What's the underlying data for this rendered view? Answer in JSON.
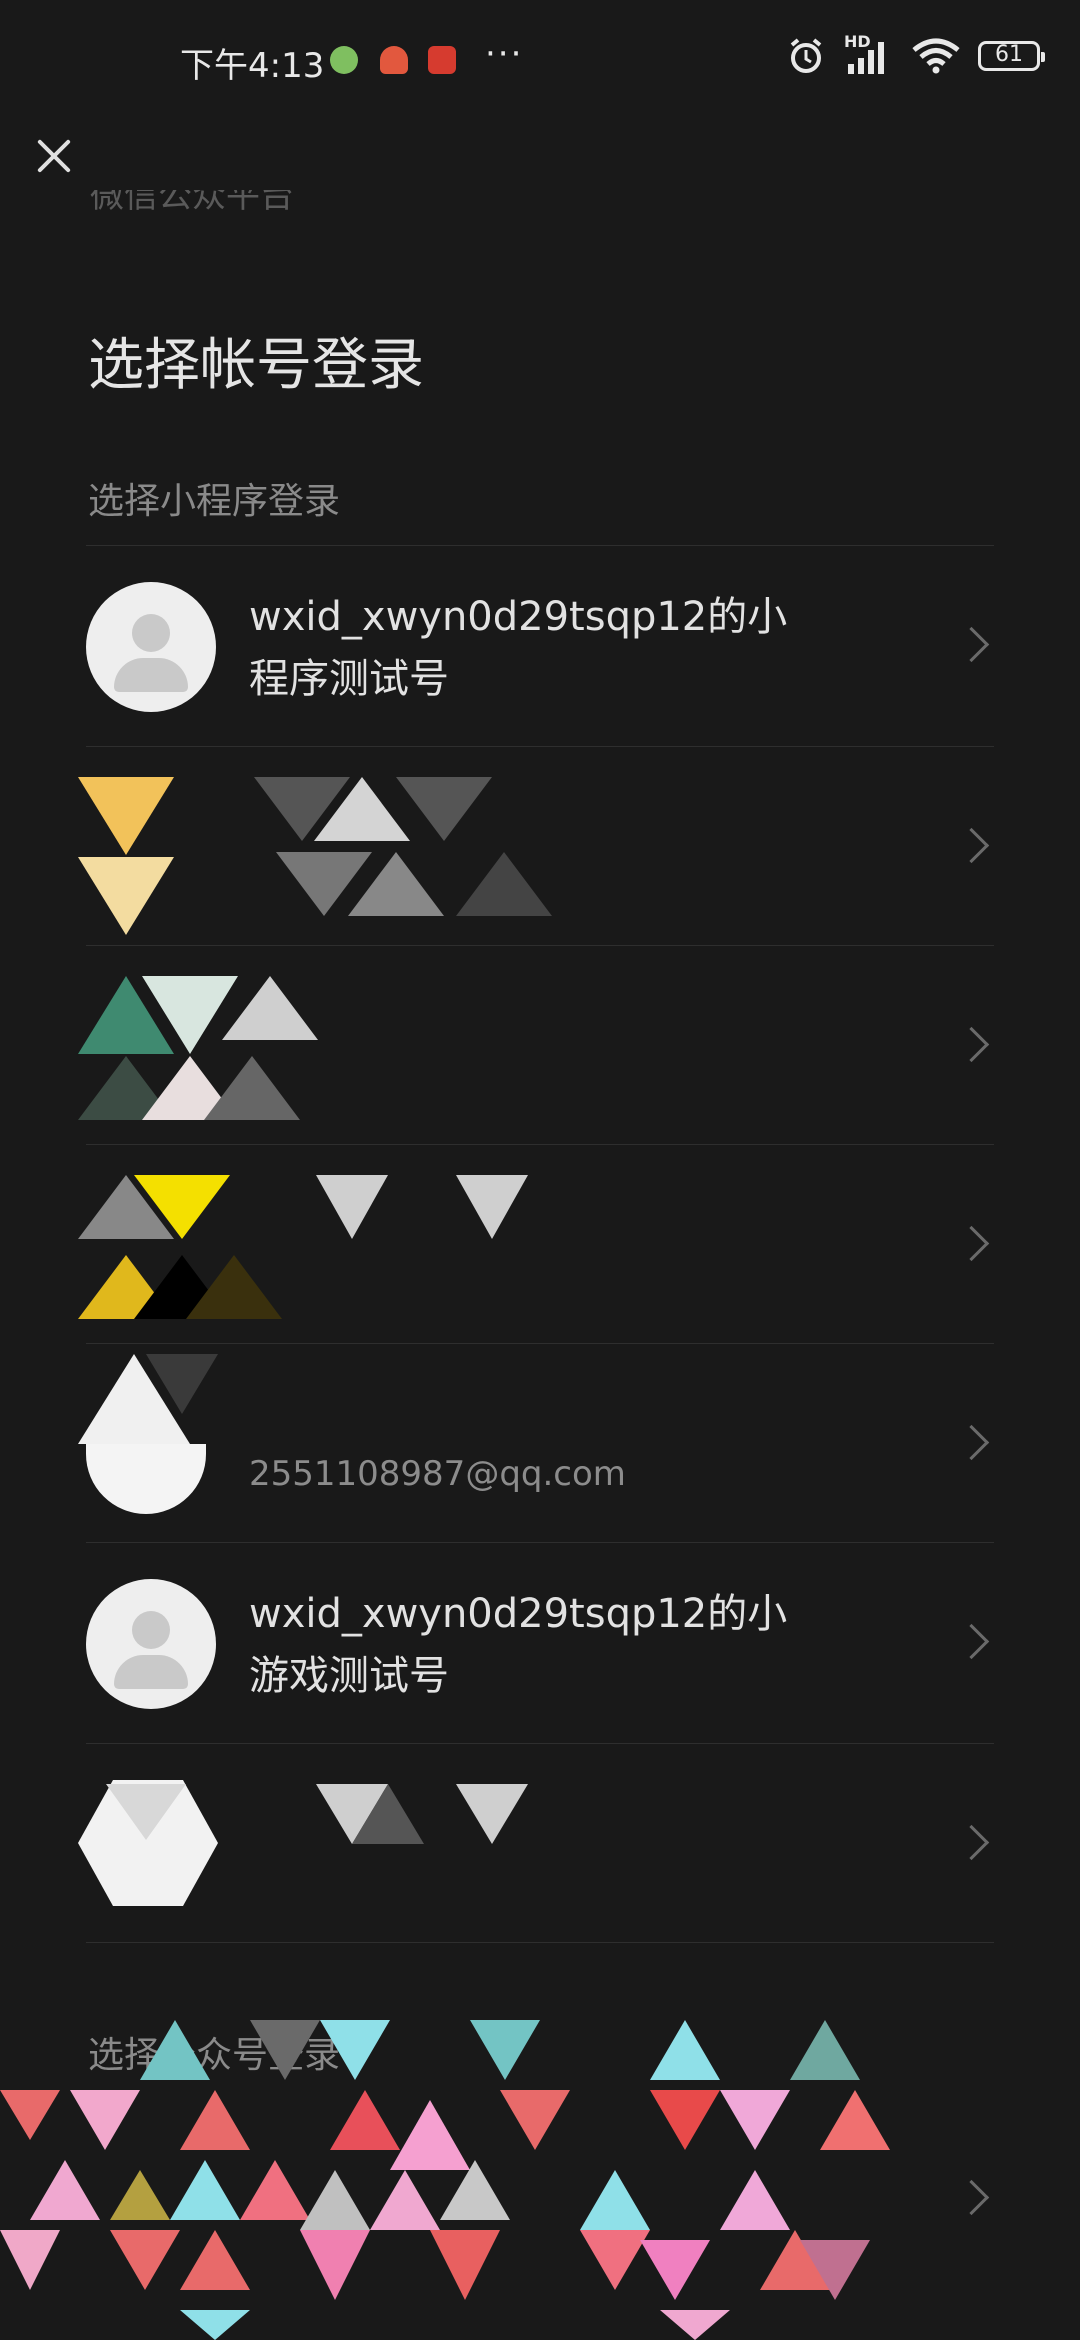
{
  "status_bar": {
    "time": "下午4:13",
    "network_badge": "HD",
    "battery": "61",
    "overflow": "···",
    "icons": [
      "wechat-notification-icon",
      "mushroom-app-icon",
      "red-app-icon",
      "alarm-icon",
      "signal-icon",
      "wifi-icon",
      "battery-icon"
    ]
  },
  "header": {
    "close_icon": "close-icon",
    "partial_header_text": "微信公众平台",
    "title": "选择帐号登录"
  },
  "section_mini_program": {
    "label": "选择小程序登录",
    "rows": [
      {
        "name": "wxid_xwyn0d29tsqp12的小程序测试号",
        "subtitle": "",
        "avatar": "default-user-avatar"
      },
      {
        "name": "",
        "subtitle": "",
        "avatar": "obscured-avatar"
      },
      {
        "name": "",
        "subtitle": "",
        "avatar": "obscured-avatar"
      },
      {
        "name": "",
        "subtitle": "",
        "avatar": "obscured-avatar"
      },
      {
        "name": "",
        "subtitle": "2551108987@qq.com",
        "avatar": "obscured-avatar"
      },
      {
        "name": "wxid_xwyn0d29tsqp12的小游戏测试号",
        "subtitle": "",
        "avatar": "default-user-avatar"
      },
      {
        "name": "",
        "subtitle": "",
        "avatar": "obscured-avatar"
      }
    ]
  },
  "section_second": {
    "label": "选择公众号登录"
  },
  "colors": {
    "background": "#191919",
    "text_primary": "#e2e2e2",
    "text_secondary": "#8a8a8a",
    "divider": "#2e2e2e"
  }
}
